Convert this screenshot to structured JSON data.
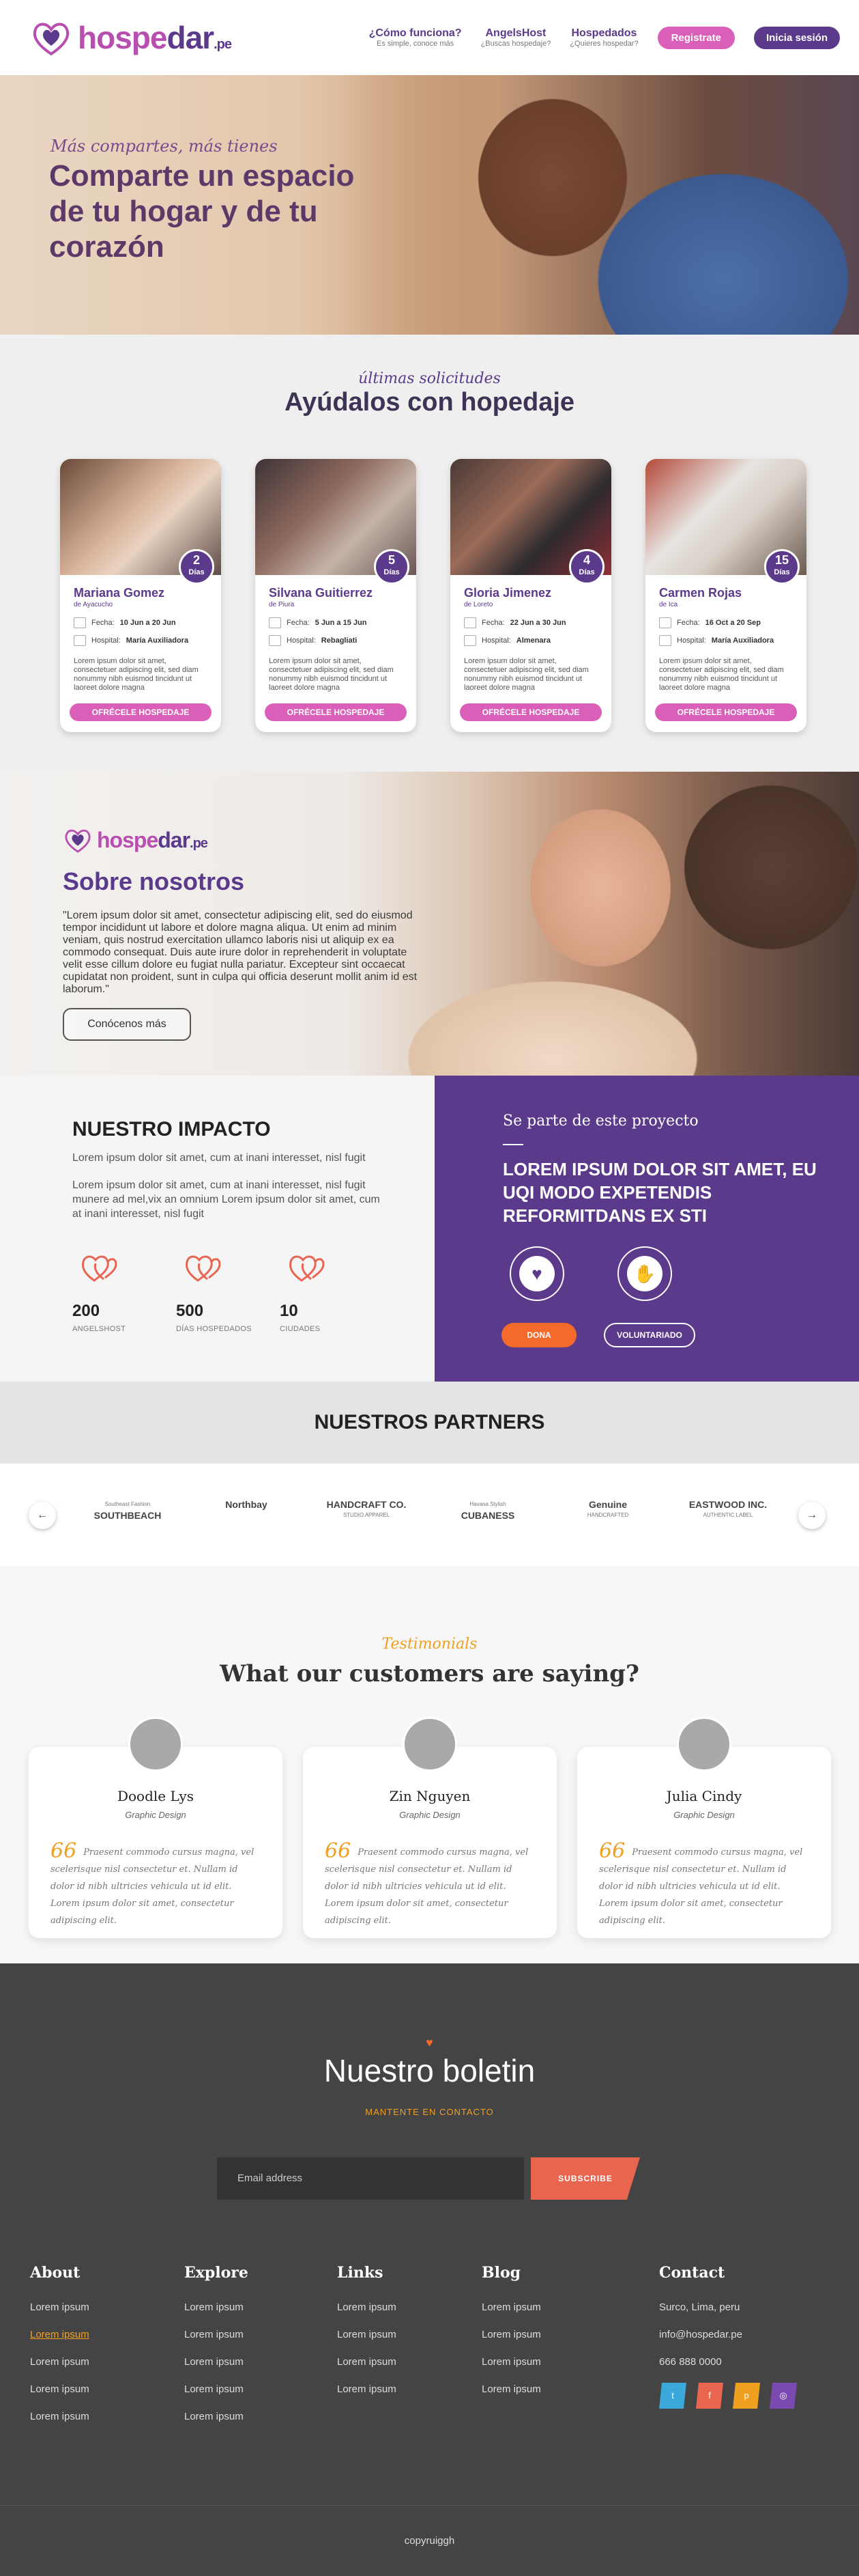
{
  "header": {
    "logo": {
      "part1": "hospe",
      "part2": "dar",
      "suffix": ".pe"
    },
    "nav": [
      {
        "title": "¿Cómo funciona?",
        "sub": "Es simple, conoce más"
      },
      {
        "title": "AngelsHost",
        "sub": "¿Buscas hospedaje?"
      },
      {
        "title": "Hospedados",
        "sub": "¿Quieres hospedar?"
      }
    ],
    "register_label": "Registrate",
    "login_label": "Inicia sesión"
  },
  "hero": {
    "subtitle": "Más compartes, más tienes",
    "title": "Comparte un espacio de tu hogar y de tu corazón"
  },
  "requests": {
    "kicker": "últimas solicitudes",
    "title": "Ayúdalos con hopedaje",
    "cards": [
      {
        "name": "Mariana Gomez",
        "location": "de Ayacucho",
        "days_num": "2",
        "days_label": "Días",
        "date_label": "Fecha:",
        "date": "10 Jun a 20 Jun",
        "hospital_label": "Hospital:",
        "hospital": "María Auxiliadora",
        "text": "Lorem ipsum dolor sit amet, consectetuer adipiscing elit, sed diam nonummy nibh euismod tincidunt ut laoreet dolore magna",
        "button": "OFRÉCELE HOSPEDAJE"
      },
      {
        "name": "Silvana Guitierrez",
        "location": "de Piura",
        "days_num": "5",
        "days_label": "Días",
        "date_label": "Fecha:",
        "date": "5 Jun a 15 Jun",
        "hospital_label": "Hospital:",
        "hospital": "Rebagliati",
        "text": "Lorem ipsum dolor sit amet, consectetuer adipiscing elit, sed diam nonummy nibh euismod tincidunt ut laoreet dolore magna",
        "button": "OFRÉCELE HOSPEDAJE"
      },
      {
        "name": "Gloria Jimenez",
        "location": "de Loreto",
        "days_num": "4",
        "days_label": "Días",
        "date_label": "Fecha:",
        "date": "22 Jun a 30 Jun",
        "hospital_label": "Hospital:",
        "hospital": "Almenara",
        "text": "Lorem ipsum dolor sit amet, consectetuer adipiscing elit, sed diam nonummy nibh euismod tincidunt ut laoreet dolore magna",
        "button": "OFRÉCELE HOSPEDAJE"
      },
      {
        "name": "Carmen Rojas",
        "location": "de Ica",
        "days_num": "15",
        "days_label": "Días",
        "date_label": "Fecha:",
        "date": "16 Oct a 20 Sep",
        "hospital_label": "Hospital:",
        "hospital": "María Auxiliadora",
        "text": "Lorem ipsum dolor sit amet, consectetuer adipiscing elit, sed diam nonummy nibh euismod tincidunt ut laoreet dolore magna",
        "button": "OFRÉCELE HOSPEDAJE"
      }
    ]
  },
  "about": {
    "title": "Sobre nosotros",
    "quote": "\"Lorem ipsum dolor sit amet, consectetur adipiscing elit, sed do eiusmod tempor incididunt ut labore et dolore magna aliqua. Ut enim ad minim veniam, quis nostrud exercitation ullamco laboris nisi ut aliquip ex ea commodo consequat. Duis aute irure dolor in reprehenderit in voluptate velit esse cillum dolore eu fugiat nulla pariatur. Excepteur sint occaecat cupidatat non proident, sunt in culpa qui officia deserunt mollit anim id est laborum.\"",
    "button": "Conócenos más"
  },
  "impact": {
    "title": "NUESTRO IMPACTO",
    "p1": "Lorem ipsum dolor sit amet, cum at inani interesset, nisl fugit",
    "p2": "Lorem ipsum dolor sit amet, cum at inani interesset, nisl fugit munere ad mel,vix an omnium Lorem ipsum dolor sit amet, cum at inani interesset, nisl fugit",
    "stats": [
      {
        "num": "200",
        "label": "ANGELSHOST"
      },
      {
        "num": "500",
        "label": "DÍAS HOSPEDADOS"
      },
      {
        "num": "10",
        "label": "CIUDADES"
      }
    ]
  },
  "project": {
    "kicker": "Se parte de este proyecto",
    "title": "LOREM IPSUM DOLOR SIT AMET, EU UQI MODO EXPETENDIS REFORMITDANS EX STI",
    "dona": "DONA",
    "voluntariado": "VOLUNTARIADO"
  },
  "partners": {
    "title": "NUESTROS PARTNERS",
    "logos": [
      {
        "name": "SOUTHBEACH",
        "sub": "Southeast Fashion"
      },
      {
        "name": "Northbay",
        "sub": ""
      },
      {
        "name": "HANDCRAFT CO.",
        "sub": "STUDIO APPAREL"
      },
      {
        "name": "CUBANESS",
        "sub": "Havana Stylish"
      },
      {
        "name": "Genuine",
        "sub": "HANDCRAFTED"
      },
      {
        "name": "EASTWOOD INC.",
        "sub": "AUTHENTIC LABEL"
      }
    ]
  },
  "testimonials": {
    "kicker": "Testimonials",
    "title": "What our customers are saying?",
    "items": [
      {
        "name": "Doodle Lys",
        "role": "Graphic Design",
        "mark": "66",
        "text": "Praesent commodo cursus magna, vel scelerisque nisl consectetur et. Nullam id dolor id nibh ultricies vehicula ut id elit. Lorem ipsum dolor sit amet, consectetur adipiscing elit."
      },
      {
        "name": "Zin Nguyen",
        "role": "Graphic Design",
        "mark": "66",
        "text": "Praesent commodo cursus magna, vel scelerisque nisl consectetur et. Nullam id dolor id nibh ultricies vehicula ut id elit. Lorem ipsum dolor sit amet, consectetur adipiscing elit."
      },
      {
        "name": "Julia Cindy",
        "role": "Graphic Design",
        "mark": "66",
        "text": "Praesent commodo cursus magna, vel scelerisque nisl consectetur et. Nullam id dolor id nibh ultricies vehicula ut id elit. Lorem ipsum dolor sit amet, consectetur adipiscing elit."
      }
    ]
  },
  "newsletter": {
    "title": "Nuestro boletin",
    "sub": "MANTENTE EN CONTACTO",
    "placeholder": "Email address",
    "button": "SUBSCRIBE"
  },
  "footer": {
    "about": {
      "title": "About",
      "items": [
        "Lorem ipsum",
        "Lorem ipsum",
        "Lorem ipsum",
        "Lorem ipsum",
        "Lorem ipsum"
      ]
    },
    "explore": {
      "title": "Explore",
      "items": [
        "Lorem ipsum",
        "Lorem ipsum",
        "Lorem ipsum",
        "Lorem ipsum",
        "Lorem ipsum"
      ]
    },
    "links": {
      "title": "Links",
      "items": [
        "Lorem ipsum",
        "Lorem ipsum",
        "Lorem ipsum",
        "Lorem ipsum"
      ]
    },
    "blog": {
      "title": "Blog",
      "items": [
        "Lorem ipsum",
        "Lorem ipsum",
        "Lorem ipsum",
        "Lorem ipsum"
      ]
    },
    "contact": {
      "title": "Contact",
      "address": "Surco, Lima, peru",
      "email": "info@hospedar.pe",
      "phone": "666 888 0000"
    },
    "social": [
      {
        "icon": "twitter-icon",
        "glyph": "t",
        "color": "#3aa8d8"
      },
      {
        "icon": "facebook-icon",
        "glyph": "f",
        "color": "#e8654f"
      },
      {
        "icon": "pinterest-icon",
        "glyph": "p",
        "color": "#f0a020"
      },
      {
        "icon": "instagram-icon",
        "glyph": "◎",
        "color": "#7b4ab0"
      }
    ],
    "copyright": "copyruiggh"
  },
  "colors": {
    "purple": "#5b3a8c",
    "pink": "#d95fb8",
    "orange": "#f46a2a",
    "gold": "#f0a020"
  }
}
